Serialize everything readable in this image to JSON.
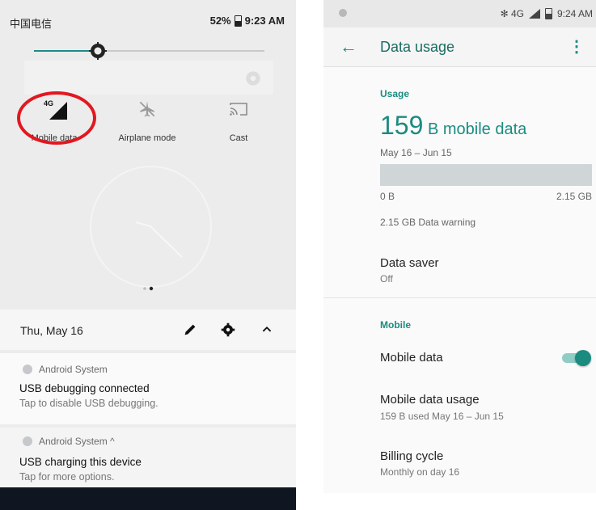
{
  "left": {
    "status": {
      "carrier": "中国电信",
      "battery": "52%",
      "time": "9:23 AM"
    },
    "tiles": [
      {
        "label": "Mobile data",
        "icon": "signal-4g-icon",
        "icon_text": "4G"
      },
      {
        "label": "Airplane mode",
        "icon": "airplane-off-icon"
      },
      {
        "label": "Cast",
        "icon": "cast-icon"
      }
    ],
    "date": "Thu, May 16",
    "notifications": [
      {
        "app": "Android System",
        "title": "USB debugging connected",
        "text": "Tap to disable USB debugging."
      },
      {
        "app": "Android System ^",
        "title": "USB charging this device",
        "text": "Tap for more options."
      }
    ]
  },
  "right": {
    "status": {
      "right_icons": "✻ 4G",
      "time": "9:24 AM"
    },
    "appbar": {
      "title": "Data usage",
      "back": "←",
      "more": "⋮"
    },
    "usage": {
      "section": "Usage",
      "amount": "159",
      "unit": " B mobile data",
      "range": "May 16 – Jun 15",
      "bar_min": "0 B",
      "bar_max": "2.15 GB",
      "warning": "2.15 GB Data warning"
    },
    "data_saver": {
      "title": "Data saver",
      "sub": "Off"
    },
    "mobile": {
      "section": "Mobile",
      "mobile_data_title": "Mobile data",
      "mobile_data_on": true,
      "usage_title": "Mobile data usage",
      "usage_sub": "159 B used May 16 – Jun 15",
      "billing_title": "Billing cycle",
      "billing_sub": "Monthly on day 16"
    }
  },
  "colors": {
    "accent": "#1b8b80",
    "highlight_circle": "#e3171f"
  }
}
